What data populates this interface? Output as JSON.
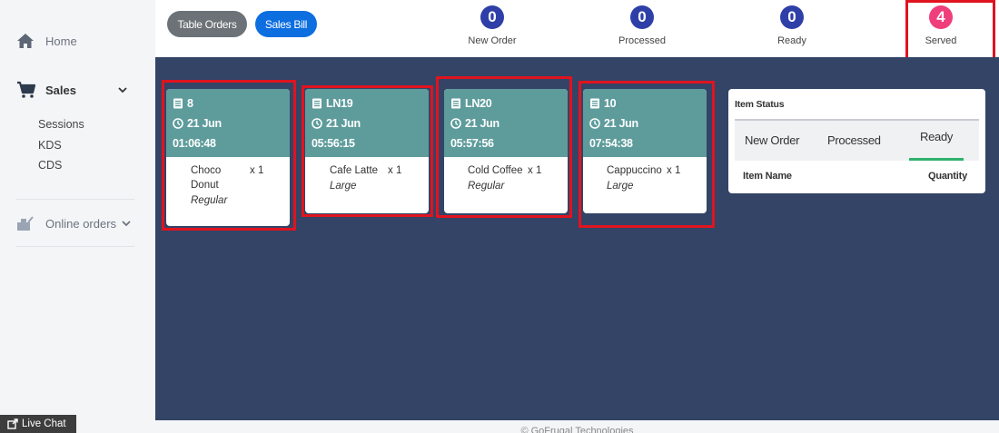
{
  "sidebar": {
    "home": "Home",
    "sales": "Sales",
    "sales_items": [
      "Sessions",
      "KDS",
      "CDS"
    ],
    "online_orders": "Online orders",
    "live_chat": "Live Chat"
  },
  "header": {
    "table_orders": "Table Orders",
    "sales_bill": "Sales Bill",
    "stats": [
      {
        "count": "0",
        "label": "New Order",
        "color": "#2f3fa8"
      },
      {
        "count": "0",
        "label": "Processed",
        "color": "#2f3fa8"
      },
      {
        "count": "0",
        "label": "Ready",
        "color": "#2f3fa8"
      },
      {
        "count": "4",
        "label": "Served",
        "color": "#ef3e7b"
      }
    ]
  },
  "tickets": [
    {
      "id": "8",
      "date": "21 Jun",
      "time": "01:06:48",
      "item_line1": "Choco",
      "item_line2": "Donut",
      "qty": "x 1",
      "modifier": "Regular"
    },
    {
      "id": "LN19",
      "date": "21 Jun",
      "time": "05:56:15",
      "item_line1": "Cafe Latte",
      "item_line2": "",
      "qty": "x 1",
      "modifier": "Large"
    },
    {
      "id": "LN20",
      "date": "21 Jun",
      "time": "05:57:56",
      "item_line1": "Cold Coffee",
      "item_line2": "",
      "qty": "x 1",
      "modifier": "Regular"
    },
    {
      "id": "10",
      "date": "21 Jun",
      "time": "07:54:38",
      "item_line1": "Cappuccino",
      "item_line2": "",
      "qty": "x 1",
      "modifier": "Large"
    }
  ],
  "item_status": {
    "title": "Item Status",
    "tabs": [
      "New Order",
      "Processed",
      "Ready"
    ],
    "active_tab": "Ready",
    "accent_color": "#2db36b",
    "columns": [
      "Item Name",
      "Quantity"
    ]
  },
  "footer": "© GoFrugal Technologies"
}
